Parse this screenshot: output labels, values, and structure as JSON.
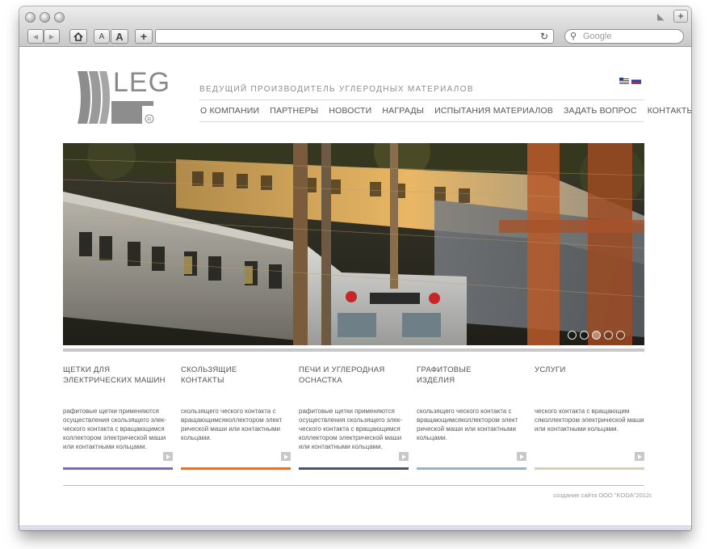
{
  "browser": {
    "search_placeholder": "Google",
    "font_small_label": "A",
    "font_large_label": "A",
    "add_label": "+",
    "back_label": "◀",
    "forward_label": "▶"
  },
  "site": {
    "logo_text": "LEG",
    "tagline": "ВЕДУЩИЙ ПРОИЗВОДИТЕЛЬ УГЛЕРОДНЫХ МАТЕРИАЛОВ",
    "nav": [
      "О КОМПАНИИ",
      "ПАРТНЕРЫ",
      "НОВОСТИ",
      "НАГРАДЫ",
      "ИСПЫТАНИЯ МАТЕРИАЛОВ",
      "ЗАДАТЬ ВОПРОС",
      "КОНТАКТЫ"
    ],
    "slider": {
      "count": 5,
      "active": 2
    },
    "columns": [
      {
        "title_1": "ЩЕТКИ ДЛЯ",
        "title_2": "ЭЛЕКТРИЧЕСКИХ  МАШИН",
        "text": "рафитовые щетки применяются осуществления скользящего элек-ческого контакта с вращающимся коллектором электрической маши или контактными кольцами.",
        "color": "#7d6ea8"
      },
      {
        "title_1": "СКОЛЬЗЯЩИЕ",
        "title_2": "КОНТАКТЫ",
        "text": "скользящего ческого контакта с вращающимсяколлектором элект рической маши или контактными кольцами.",
        "color": "#d9733a"
      },
      {
        "title_1": "ПЕЧИ И УГЛЕРОДНАЯ",
        "title_2": "ОСНАСТКА",
        "text": "рафитовые щетки применяются осуществления скользящего элек-ческого контакта с вращающимся коллектором электрической маши или контактными кольцами.",
        "color": "#4d5565"
      },
      {
        "title_1": "ГРАФИТОВЫЕ",
        "title_2": "ИЗДЕЛИЯ",
        "text": "скользящего ческого контакта с вращающимсяколлектором элект рической маши или контактными кольцами.",
        "color": "#9db3bb"
      },
      {
        "title_1": "УСЛУГИ",
        "title_2": "",
        "text": "ческого контакта с вращающим сяколлектором электрической маши или контактными кольцами.",
        "color": "#d5d0bf"
      }
    ],
    "credits": "создание сайта ООО \"KODA\"2012г."
  }
}
